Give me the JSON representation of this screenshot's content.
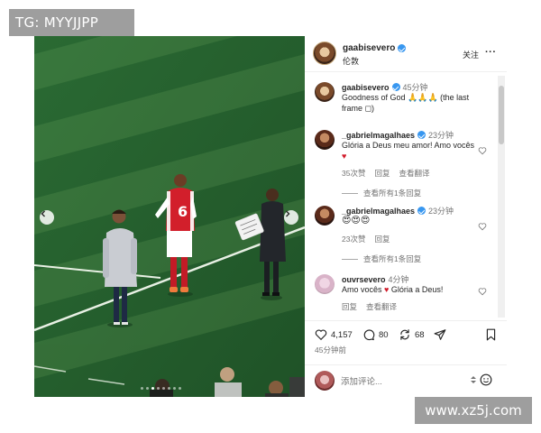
{
  "watermarks": {
    "top_left": "TG: MYYJJPP",
    "bottom_right": "www.xz5j.com"
  },
  "media": {
    "player_number": "6",
    "carousel_dots": 8,
    "active_dot": 3,
    "colors": {
      "pitch": "#2f6b35",
      "kit": "#d21f2b"
    }
  },
  "post": {
    "username": "gaabisevero",
    "location": "伦敦",
    "follow_label": "关注",
    "more_label": "···"
  },
  "caption": {
    "username": "gaabisevero",
    "time": "45分钟",
    "text": "Goodness of God 🙏🙏🙏 (the last frame ◻)"
  },
  "comments": [
    {
      "username": "_gabrielmagalhaes",
      "time": "23分钟",
      "text_main": "Glória a Deus meu amor! Amo vocês ",
      "text_heart": "♥",
      "likes": "35次赞",
      "reply_label": "回复",
      "translate_label": "查看翻译",
      "view_replies": "查看所有1条回复"
    },
    {
      "username": "_gabrielmagalhaes",
      "time": "23分钟",
      "text": "😍😍😍",
      "likes": "23次赞",
      "reply_label": "回复",
      "view_replies": "查看所有1条回复"
    },
    {
      "username": "ouvrsevero",
      "time": "4分钟",
      "text_main": "Amo vocês ",
      "text_heart": "♥",
      "text_end": " Glória a Deus!",
      "reply_label": "回复",
      "translate_label": "查看翻译"
    }
  ],
  "actions": {
    "likes": "4,157",
    "comments": "80",
    "reposts": "68",
    "posted_ago": "45分钟前"
  },
  "composer": {
    "placeholder": "添加评论..."
  }
}
